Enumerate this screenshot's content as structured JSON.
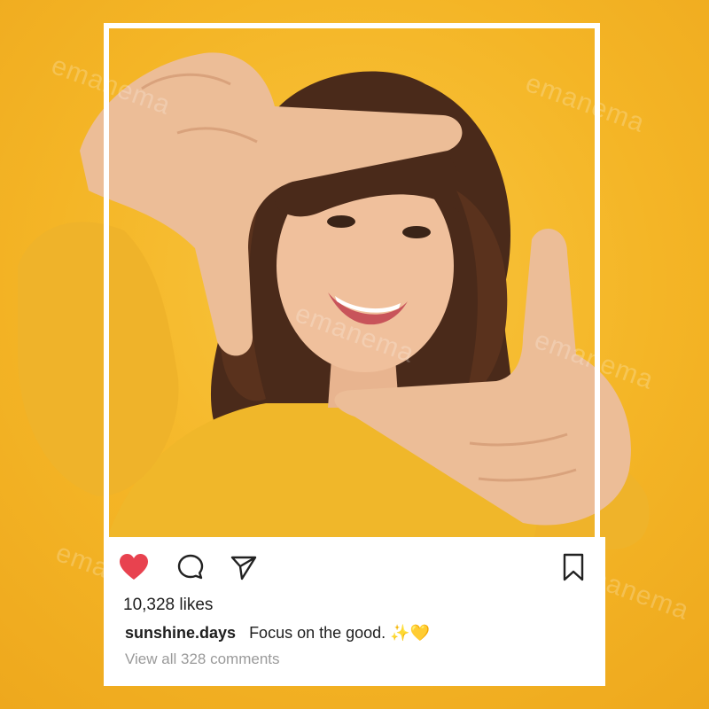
{
  "post": {
    "likes": "10,328 likes",
    "username": "sunshine.days",
    "caption": "Focus on the good. ✨💛",
    "view_comments": "View all 328 comments"
  },
  "watermark": "emanema",
  "colors": {
    "background": "#f5b82e",
    "heart": "#e8424f",
    "frame": "#ffffff",
    "sweater": "#f0b72a"
  },
  "icons": {
    "like": "heart-icon",
    "comment": "comment-icon",
    "share": "send-icon",
    "save": "bookmark-icon"
  }
}
